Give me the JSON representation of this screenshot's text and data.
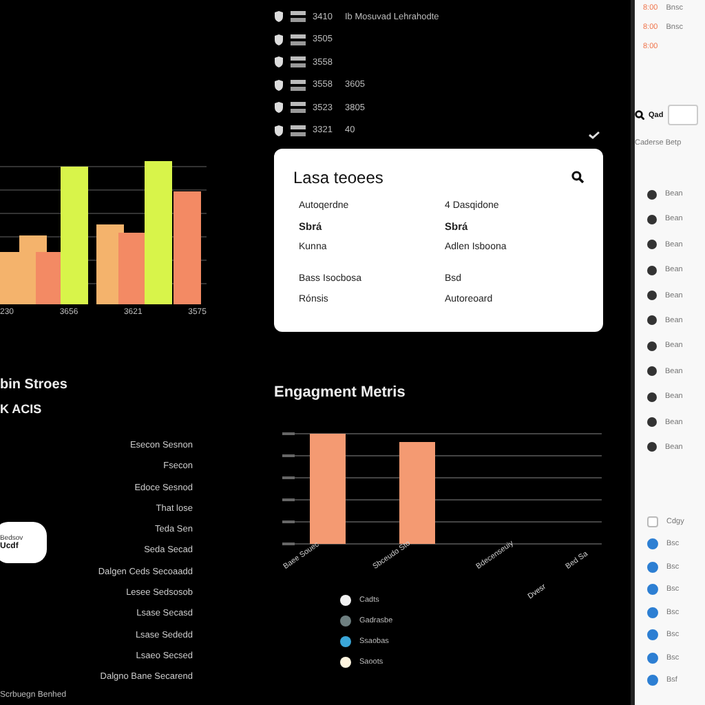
{
  "top_list": [
    {
      "code": "3410",
      "note": "Ib Mosuvad Lehrahodte"
    },
    {
      "code": "3505"
    },
    {
      "code": "3558"
    },
    {
      "code": "3558",
      "note": "3605"
    },
    {
      "code": "3523",
      "note": "3805"
    },
    {
      "code": "3321",
      "note": "40"
    }
  ],
  "sales_chart": {
    "labels": [
      "230",
      "3656",
      "3621",
      "3575"
    ]
  },
  "dialog": {
    "title": "Lasa teoees",
    "items": [
      [
        "Autoqerdne",
        "4 Dasqidone"
      ],
      [
        "Sbrá",
        "Sbrá"
      ],
      [
        "Kunna",
        "Adlen Isboona"
      ],
      [
        "Bass Isocbosa",
        "Bsd"
      ],
      [
        "Rónsis",
        "Autoreoard"
      ]
    ]
  },
  "left_panel": {
    "title": "bin Stroes",
    "subtitle": "K ACIS",
    "bubble": [
      "Bedsov",
      "Ucdf"
    ],
    "footer": "Scrbuegn Benhed",
    "items": [
      "Esecon Sesnon",
      "Fsecon",
      "Edoce Sesnod",
      "That lose",
      "Teda Sen",
      "Seda Secad",
      "Dalgen Ceds Secoaadd",
      "Lesee Sedsosob",
      "Lsase Secasd",
      "Lsase Sededd",
      "Lsaeo Secsed",
      "Dalgno Bane Secarend"
    ]
  },
  "engagement": {
    "title": "Engagment Metris",
    "labels": [
      "Baee Souec",
      "Sbceudo Sto",
      "Bdecenseuiy",
      "Bed Sa"
    ],
    "extra_label": "Dvesr",
    "legend": [
      {
        "label": "Cadts",
        "color": "#f2f2f2"
      },
      {
        "label": "Gadrasbe",
        "color": "#6e7f80"
      },
      {
        "label": "Ssaobas",
        "color": "#3aa6d8"
      },
      {
        "label": "Saoots",
        "color": "#fff6e0"
      }
    ]
  },
  "side": {
    "times": [
      {
        "time": "8:00",
        "text": "Bnsc"
      },
      {
        "time": "8:00",
        "text": "Bnsc"
      },
      {
        "time": "8:00"
      }
    ],
    "search_label": "Qad",
    "caption": "Caderse Betp",
    "rows": [
      "Bean",
      "Bean",
      "Bean",
      "Bean",
      "Bean",
      "Bean",
      "Bean",
      "Bean",
      "Bean",
      "Bean",
      "Bean"
    ],
    "checks": [
      {
        "text": "Cdgy",
        "checked": false
      },
      {
        "text": "Bsc",
        "checked": true
      },
      {
        "text": "Bsc",
        "checked": true
      },
      {
        "text": "Bsc",
        "checked": true
      },
      {
        "text": "Bsc",
        "checked": true
      },
      {
        "text": "Bsc",
        "checked": true
      },
      {
        "text": "Bsc",
        "checked": true
      },
      {
        "text": "Bsf",
        "checked": true
      }
    ]
  }
}
